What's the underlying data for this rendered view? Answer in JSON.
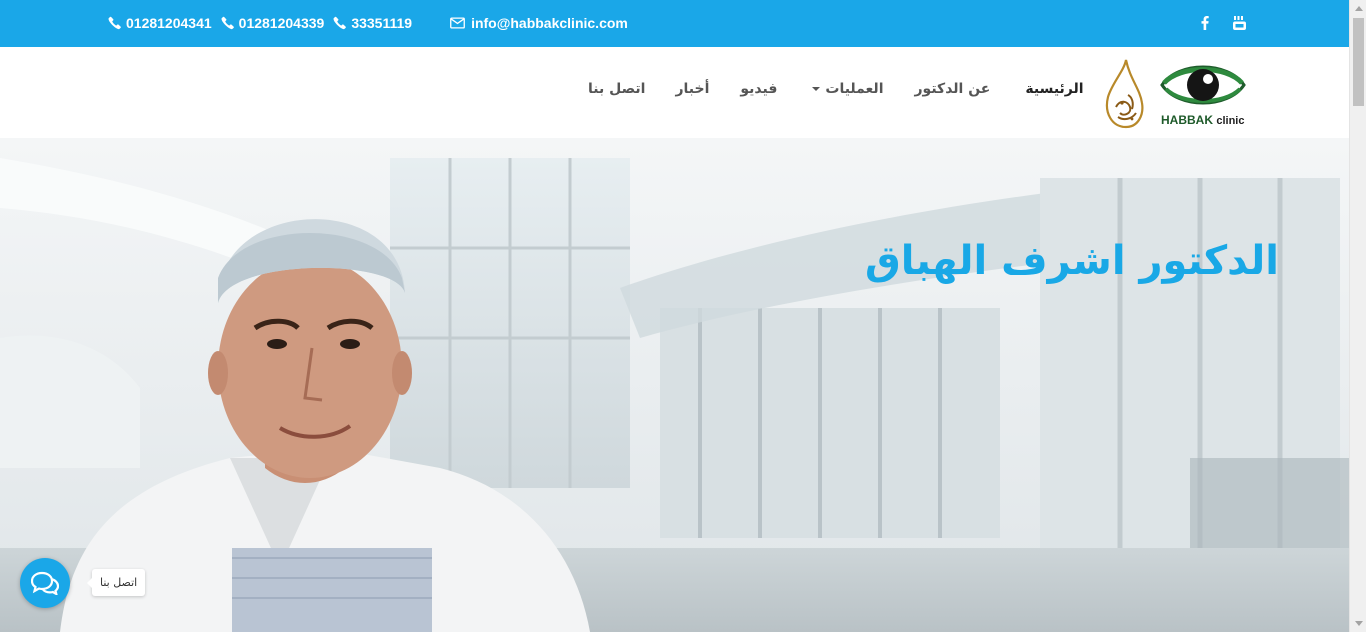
{
  "topbar": {
    "phones": [
      {
        "icon": "phone-icon",
        "number": "01281204341"
      },
      {
        "icon": "phone-icon",
        "number": "01281204339"
      },
      {
        "icon": "phone-icon",
        "number": "33351119"
      }
    ],
    "email": {
      "icon": "envelope-icon",
      "address": "info@habbakclinic.com"
    },
    "social": [
      {
        "icon": "facebook-icon"
      },
      {
        "icon": "youtube-icon"
      }
    ],
    "color": "#1aa7e8"
  },
  "nav": {
    "items": [
      {
        "label": "الرئيسية",
        "active": true
      },
      {
        "label": "عن الدكتور",
        "active": false
      },
      {
        "label": "العمليات",
        "active": false,
        "dropdown": true
      },
      {
        "label": "فيديو",
        "active": false
      },
      {
        "label": "أخبار",
        "active": false
      },
      {
        "label": "اتصل بنا",
        "active": false
      }
    ]
  },
  "logo": {
    "brand": "HABBAK",
    "suffix": "clinic"
  },
  "hero": {
    "title": "الدكتور اشرف الهباق",
    "title_color": "#19a8e6"
  },
  "chat": {
    "icon": "chat-bubbles-icon",
    "tooltip": "اتصل بنا"
  }
}
